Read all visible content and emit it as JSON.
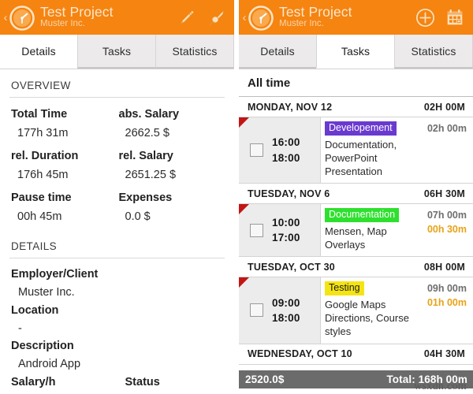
{
  "app": {
    "brand_color": "#f58410",
    "title": "Test Project",
    "subtitle": "Muster Inc.",
    "logo_icon": "clock-speedometer-icon"
  },
  "left_panel": {
    "actionbar": {
      "up_caret": "‹",
      "title": "Test Project",
      "subtitle": "Muster Inc.",
      "icons": [
        {
          "name": "edit-pencil-icon",
          "label": "Edit"
        },
        {
          "name": "pin-icon",
          "label": "Pin"
        }
      ]
    },
    "tabs": [
      {
        "label": "Details",
        "active": true
      },
      {
        "label": "Tasks",
        "active": false
      },
      {
        "label": "Statistics",
        "active": false
      }
    ],
    "overview": {
      "heading": "OVERVIEW",
      "entries": [
        {
          "label": "Total Time",
          "value": "177h 31m"
        },
        {
          "label": "abs. Salary",
          "value": "2662.5 $"
        },
        {
          "label": "rel. Duration",
          "value": "176h 45m"
        },
        {
          "label": "rel. Salary",
          "value": "2651.25 $"
        },
        {
          "label": "Pause time",
          "value": "00h 45m"
        },
        {
          "label": "Expenses",
          "value": "0.0 $"
        }
      ]
    },
    "details": {
      "heading": "DETAILS",
      "employer_label": "Employer/Client",
      "employer_value": "Muster Inc.",
      "location_label": "Location",
      "location_value": "-",
      "description_label": "Description",
      "description_value": "Android App",
      "salary_label": "Salary/h",
      "status_label": "Status"
    }
  },
  "right_panel": {
    "actionbar": {
      "up_caret": "‹",
      "title": "Test Project",
      "subtitle": "Muster Inc.",
      "icons": [
        {
          "name": "add-circle-icon",
          "label": "Add"
        },
        {
          "name": "calendar-icon",
          "label": "Calendar"
        }
      ]
    },
    "tabs": [
      {
        "label": "Details",
        "active": false
      },
      {
        "label": "Tasks",
        "active": true
      },
      {
        "label": "Statistics",
        "active": false
      }
    ],
    "list_header": "All time",
    "days": [
      {
        "date": "MONDAY, NOV 12",
        "total": "02H 00M",
        "task": {
          "start": "16:00",
          "end": "18:00",
          "tag": "Developement",
          "tag_color": "#6a3ad0",
          "description": "Documentation, PowerPoint Presentation",
          "duration": "02h 00m",
          "pause": ""
        }
      },
      {
        "date": "TUESDAY, NOV 6",
        "total": "06H 30M",
        "task": {
          "start": "10:00",
          "end": "17:00",
          "tag": "Documentation",
          "tag_color": "#2ee02e",
          "description": "Mensen, Map Overlays",
          "duration": "07h 00m",
          "pause": "00h 30m"
        }
      },
      {
        "date": "TUESDAY, OCT 30",
        "total": "08H 00M",
        "task": {
          "start": "09:00",
          "end": "18:00",
          "tag": "Testing",
          "tag_color": "#f5e414",
          "description": "Google Maps Directions, Course styles",
          "duration": "09h 00m",
          "pause": "01h 00m"
        }
      },
      {
        "date": "WEDNESDAY, OCT 10",
        "total": "04H 30M",
        "task": null
      }
    ],
    "footer": {
      "amount": "2520.0$",
      "total": "Total: 168h 00m",
      "background": "#6b6b6b"
    }
  },
  "watermark": "wsxdn.com"
}
